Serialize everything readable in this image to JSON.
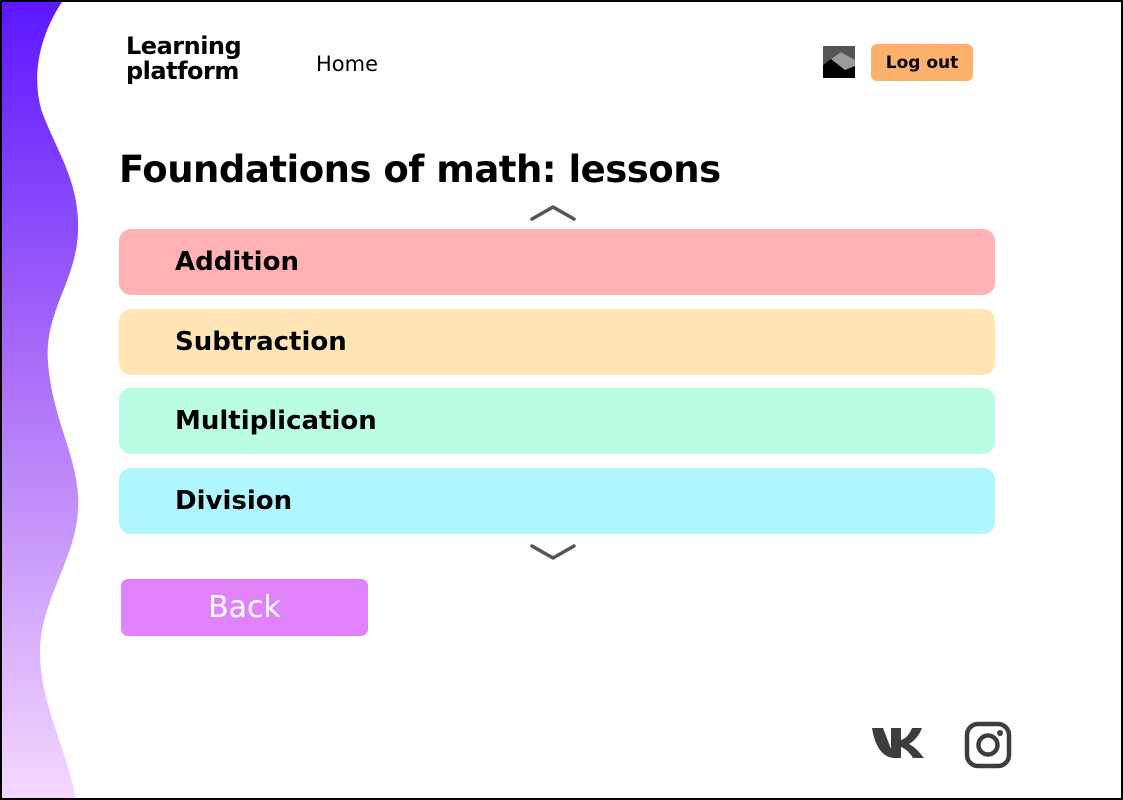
{
  "header": {
    "logo_line1": "Learning",
    "logo_line2": "platform",
    "nav_home": "Home",
    "avatar_icon": "image-placeholder-icon",
    "logout_label": "Log out"
  },
  "main": {
    "title": "Foundations of math: lessons",
    "scroll_up_icon": "chevron-up-icon",
    "scroll_down_icon": "chevron-down-icon",
    "lessons": [
      {
        "label": "Addition",
        "color": "#ffb1b3"
      },
      {
        "label": "Subtraction",
        "color": "#fee5b3"
      },
      {
        "label": "Multiplication",
        "color": "#bbfde2"
      },
      {
        "label": "Division",
        "color": "#aff5fd"
      }
    ],
    "back_label": "Back"
  },
  "footer": {
    "social_icons": [
      "vk-icon",
      "instagram-icon"
    ]
  },
  "colors": {
    "logout_button": "#fbb06c",
    "back_button": "#df82fb",
    "wave_top": "#5b17ff",
    "wave_bottom": "#f5d8fd"
  }
}
